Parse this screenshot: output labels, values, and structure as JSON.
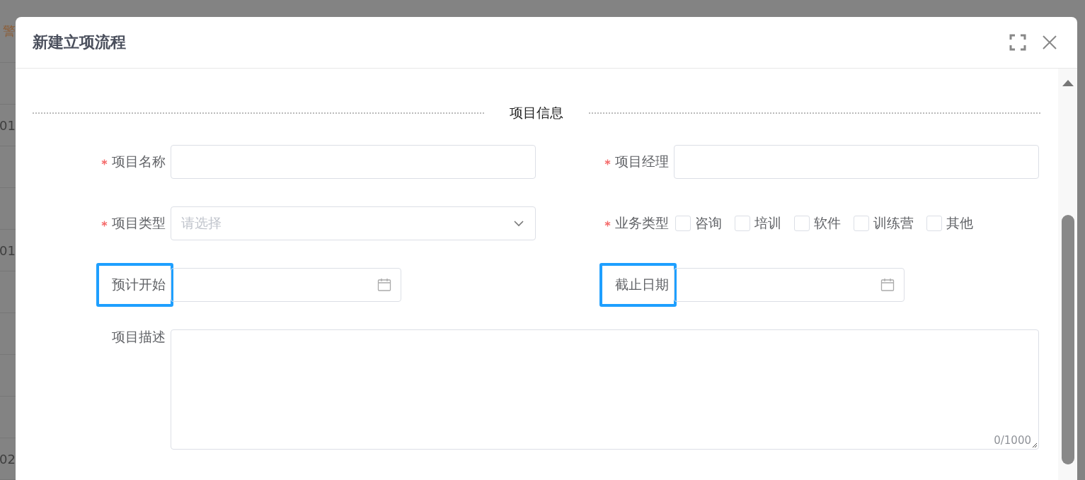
{
  "background": {
    "fragments": [
      {
        "text": "警",
        "kind": "warning"
      },
      {
        "text": "01",
        "kind": "plain"
      },
      {
        "text": "01",
        "kind": "plain"
      },
      {
        "text": "02",
        "kind": "plain"
      }
    ]
  },
  "window": {
    "title": "新建立项流程"
  },
  "section": {
    "title": "项目信息"
  },
  "fields": [
    {
      "kind": "text",
      "label": "项目名称",
      "required": true,
      "highlighted": false
    },
    {
      "kind": "text",
      "label": "项目经理",
      "required": true,
      "highlighted": false
    },
    {
      "kind": "select",
      "label": "项目类型",
      "required": true,
      "highlighted": false,
      "placeholder": "请选择"
    },
    {
      "kind": "checkboxes",
      "label": "业务类型",
      "required": true,
      "highlighted": false,
      "options": [
        {
          "label": "咨询",
          "checked": false
        },
        {
          "label": "培训",
          "checked": false
        },
        {
          "label": "软件",
          "checked": false
        },
        {
          "label": "训练营",
          "checked": false
        },
        {
          "label": "其他",
          "checked": false
        }
      ]
    },
    {
      "kind": "date",
      "label": "预计开始",
      "required": false,
      "highlighted": true
    },
    {
      "kind": "date",
      "label": "截止日期",
      "required": false,
      "highlighted": true
    },
    {
      "kind": "textarea",
      "label": "项目描述",
      "required": false,
      "highlighted": false,
      "counter": "0/1000"
    }
  ]
}
